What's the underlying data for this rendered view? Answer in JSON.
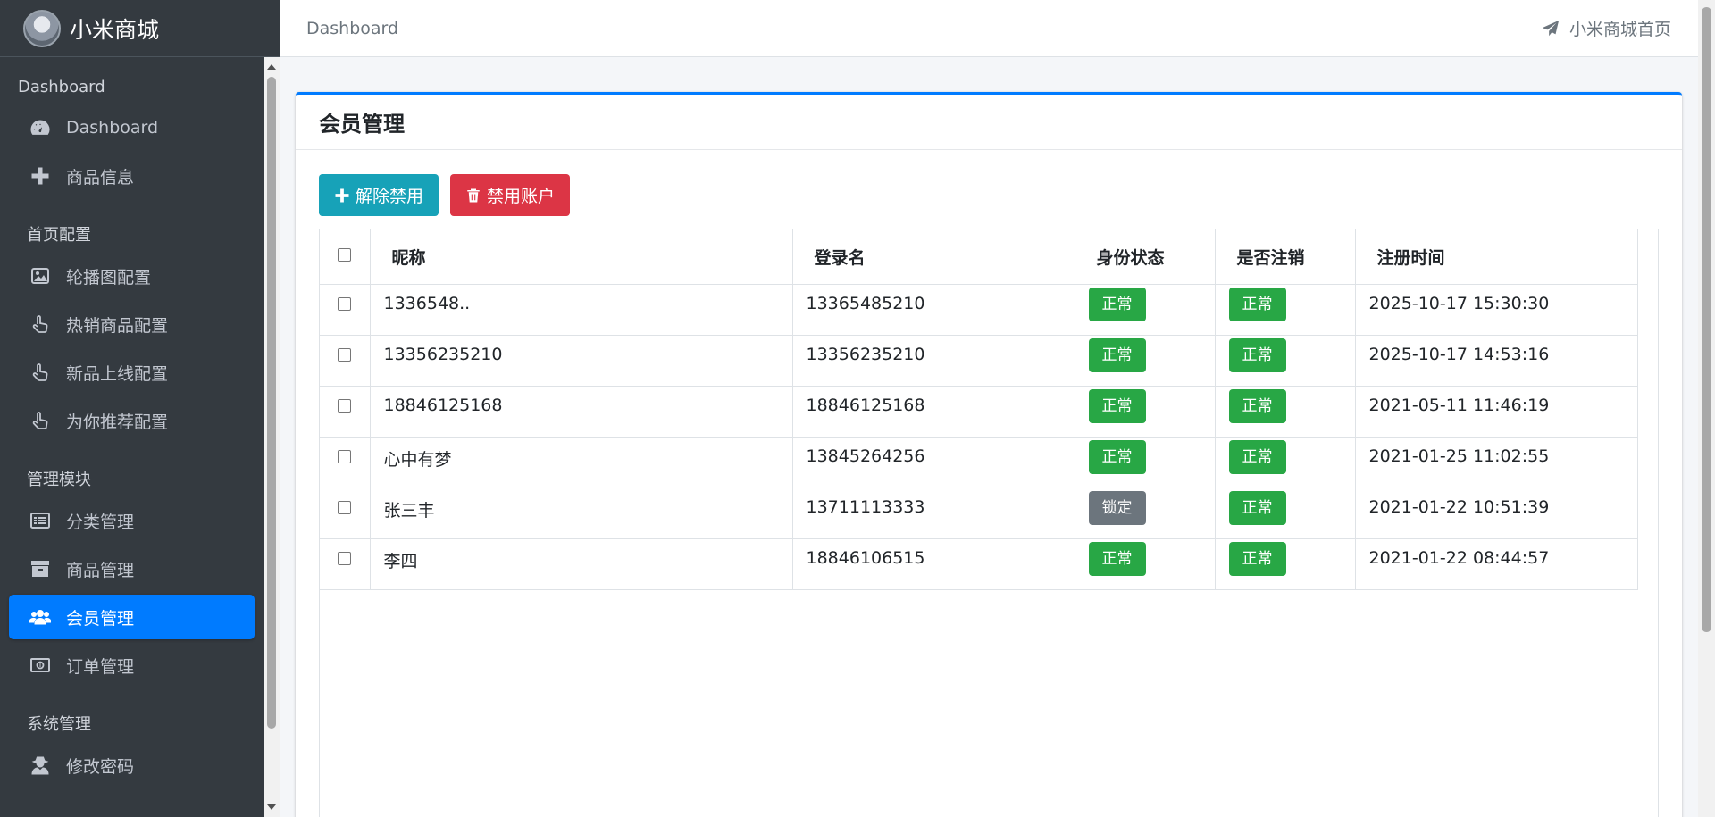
{
  "brand": {
    "name": "小米商城"
  },
  "sidebar": {
    "sections": [
      {
        "header": "Dashboard",
        "items": [
          {
            "label": "Dashboard",
            "icon": "tachometer-icon"
          },
          {
            "label": "商品信息",
            "icon": "plus-icon"
          }
        ]
      },
      {
        "header": "首页配置",
        "items": [
          {
            "label": "轮播图配置",
            "icon": "image-icon"
          },
          {
            "label": "热销商品配置",
            "icon": "hand-pointer-icon"
          },
          {
            "label": "新品上线配置",
            "icon": "hand-pointer-icon"
          },
          {
            "label": "为你推荐配置",
            "icon": "hand-pointer-icon"
          }
        ]
      },
      {
        "header": "管理模块",
        "items": [
          {
            "label": "分类管理",
            "icon": "list-icon"
          },
          {
            "label": "商品管理",
            "icon": "archive-icon"
          },
          {
            "label": "会员管理",
            "icon": "users-icon",
            "active": true
          },
          {
            "label": "订单管理",
            "icon": "money-icon"
          }
        ]
      },
      {
        "header": "系统管理",
        "items": [
          {
            "label": "修改密码",
            "icon": "user-secret-icon"
          }
        ]
      }
    ]
  },
  "topbar": {
    "breadcrumb": "Dashboard",
    "home_link": "小米商城首页",
    "home_icon": "paper-plane-icon"
  },
  "card": {
    "title": "会员管理"
  },
  "toolbar": {
    "unban_label": "解除禁用",
    "ban_label": "禁用账户"
  },
  "table": {
    "headers": [
      "昵称",
      "登录名",
      "身份状态",
      "是否注销",
      "注册时间"
    ],
    "rows": [
      {
        "nick": "1336548..",
        "login": "13365485210",
        "status": "正常",
        "cancel": "正常",
        "time": "2025-10-17 15:30:30"
      },
      {
        "nick": "13356235210",
        "login": "13356235210",
        "status": "正常",
        "cancel": "正常",
        "time": "2025-10-17 14:53:16"
      },
      {
        "nick": "18846125168",
        "login": "18846125168",
        "status": "正常",
        "cancel": "正常",
        "time": "2021-05-11 11:46:19"
      },
      {
        "nick": "心中有梦",
        "login": "13845264256",
        "status": "正常",
        "cancel": "正常",
        "time": "2021-01-25 11:02:55"
      },
      {
        "nick": "张三丰",
        "login": "13711113333",
        "status": "锁定",
        "cancel": "正常",
        "time": "2021-01-22 10:51:39"
      },
      {
        "nick": "李四",
        "login": "18846106515",
        "status": "正常",
        "cancel": "正常",
        "time": "2021-01-22 08:44:57"
      }
    ]
  },
  "colors": {
    "sidebar_bg": "#343a40",
    "active": "#007bff",
    "info": "#17a2b8",
    "danger": "#dc3545",
    "success": "#28a745",
    "secondary": "#6c757d"
  }
}
